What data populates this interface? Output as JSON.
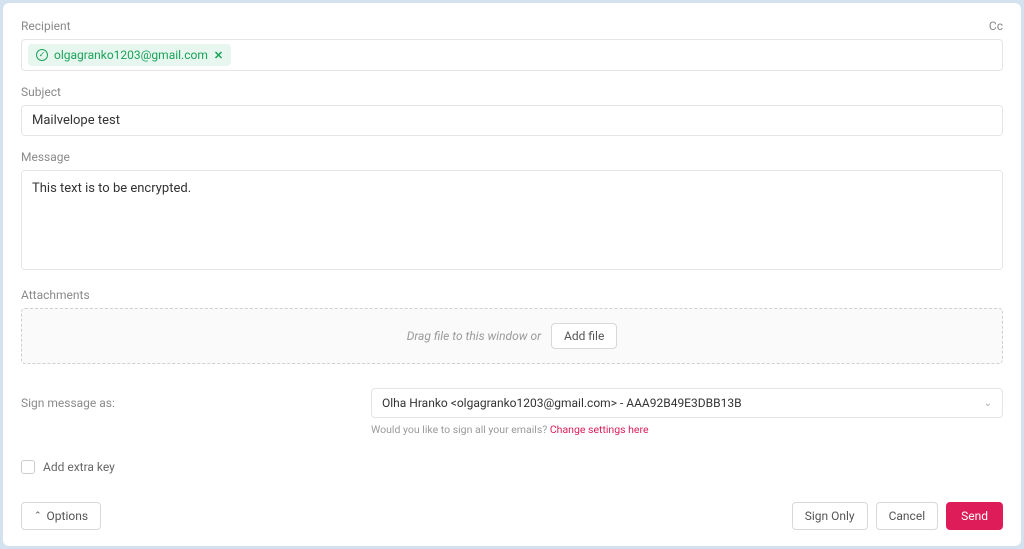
{
  "labels": {
    "recipient": "Recipient",
    "cc": "Cc",
    "subject": "Subject",
    "message": "Message",
    "attachments": "Attachments",
    "sign_as": "Sign message as:",
    "add_extra_key": "Add extra key"
  },
  "recipient": {
    "email": "olgagranko1203@gmail.com"
  },
  "subject_value": "Mailvelope test",
  "message_value": "This text is to be encrypted.",
  "attachment": {
    "drag_text": "Drag file to this window or",
    "add_file": "Add file"
  },
  "sign": {
    "selected": "Olha Hranko <olgagranko1203@gmail.com> - AAA92B49E3DBB13B",
    "hint_prefix": "Would you like to sign all your emails? ",
    "hint_link": "Change settings here"
  },
  "buttons": {
    "options": "Options",
    "sign_only": "Sign Only",
    "cancel": "Cancel",
    "send": "Send"
  }
}
